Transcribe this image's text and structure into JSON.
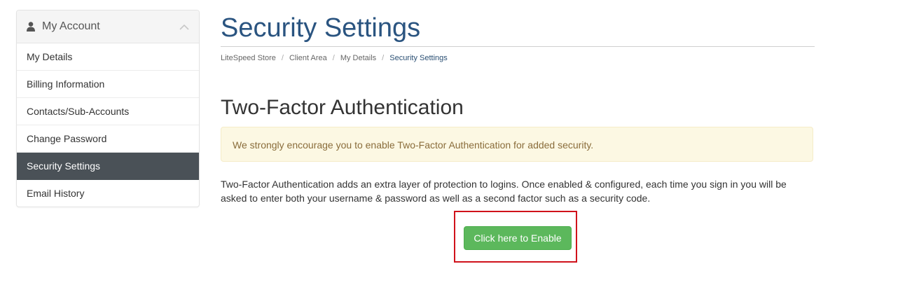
{
  "sidebar": {
    "title": "My Account",
    "items": [
      {
        "label": "My Details"
      },
      {
        "label": "Billing Information"
      },
      {
        "label": "Contacts/Sub-Accounts"
      },
      {
        "label": "Change Password"
      },
      {
        "label": "Security Settings",
        "active": true
      },
      {
        "label": "Email History"
      }
    ]
  },
  "header": {
    "title": "Security Settings",
    "breadcrumb": [
      "LiteSpeed Store",
      "Client Area",
      "My Details",
      "Security Settings"
    ]
  },
  "section": {
    "title": "Two-Factor Authentication",
    "alert": "We strongly encourage you to enable Two-Factor Authentication for added security.",
    "description": "Two-Factor Authentication adds an extra layer of protection to logins. Once enabled & configured, each time you sign in you will be asked to enter both your username & password as well as a second factor such as a security code.",
    "button_label": "Click here to Enable"
  },
  "colors": {
    "title": "#2a5480",
    "active_item": "#4a5157",
    "button": "#5cb85c",
    "alert_bg": "#fcf8e3",
    "highlight": "#d0121b"
  }
}
